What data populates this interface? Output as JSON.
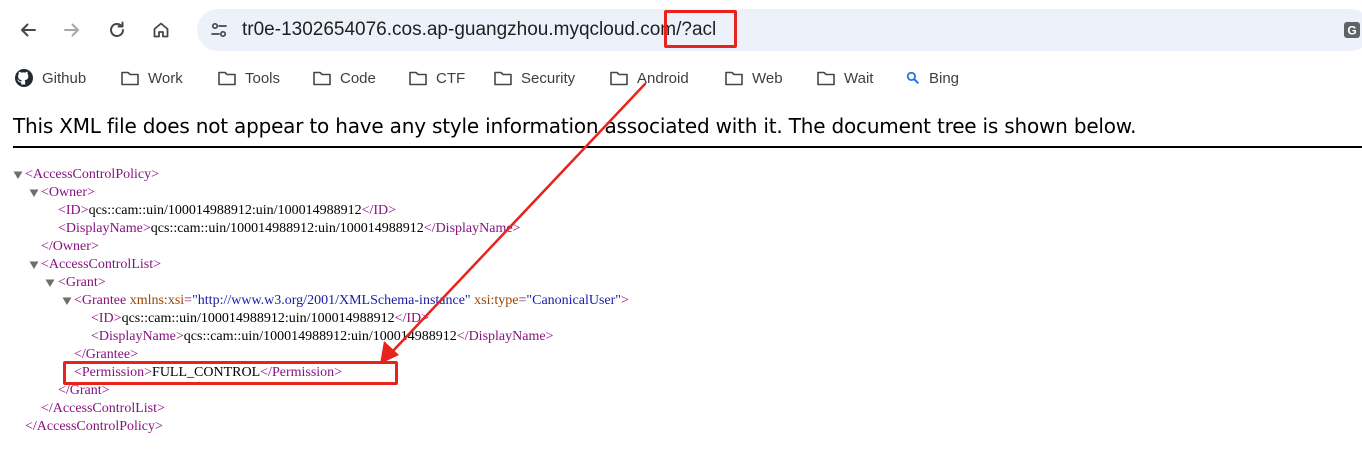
{
  "browser": {
    "url_text": "tr0e-1302654076.cos.ap-guangzhou.myqcloud.com/",
    "url_query": "?acl"
  },
  "bookmarks": [
    {
      "label": "Github",
      "icon": "github-icon"
    },
    {
      "label": "Work",
      "icon": "folder-icon"
    },
    {
      "label": "Tools",
      "icon": "folder-icon"
    },
    {
      "label": "Code",
      "icon": "folder-icon"
    },
    {
      "label": "CTF",
      "icon": "folder-icon"
    },
    {
      "label": "Security",
      "icon": "folder-icon"
    },
    {
      "label": "Android",
      "icon": "folder-icon"
    },
    {
      "label": "Web",
      "icon": "folder-icon"
    },
    {
      "label": "Wait",
      "icon": "folder-icon"
    },
    {
      "label": "Bing",
      "icon": "search-icon"
    }
  ],
  "notice": "This XML file does not appear to have any style information associated with it. The document tree is shown below.",
  "xml": {
    "root_open": "<AccessControlPolicy>",
    "owner_open": "<Owner>",
    "owner_id_open": "<ID>",
    "owner_id_value": "qcs::cam::uin/100014988912:uin/100014988912",
    "owner_id_close": "</ID>",
    "owner_dn_open": "<DisplayName>",
    "owner_dn_value": "qcs::cam::uin/100014988912:uin/100014988912",
    "owner_dn_close": "</DisplayName>",
    "owner_close": "</Owner>",
    "acl_open": "<AccessControlList>",
    "grant_open": "<Grant>",
    "grantee_tag": "<Grantee",
    "grantee_attr1_name": "xmlns:xsi",
    "grantee_attr1_value": "\"http://www.w3.org/2001/XMLSchema-instance\"",
    "grantee_attr2_name": "xsi:type",
    "grantee_attr2_value": "\"CanonicalUser\"",
    "grantee_tag_end": ">",
    "grantee_id_open": "<ID>",
    "grantee_id_value": "qcs::cam::uin/100014988912:uin/100014988912",
    "grantee_id_close": "</ID>",
    "grantee_dn_open": "<DisplayName>",
    "grantee_dn_value": "qcs::cam::uin/100014988912:uin/100014988912",
    "grantee_dn_close": "</DisplayName>",
    "grantee_close": "</Grantee>",
    "perm_open": "<Permission>",
    "perm_value": "FULL_CONTROL",
    "perm_close": "</Permission>",
    "grant_close": "</Grant>",
    "acl_close": "</AccessControlList>",
    "root_close": "</AccessControlPolicy>"
  },
  "colors": {
    "annotation_red": "#e8231b",
    "tag": "#881280",
    "attr_name": "#994500",
    "attr_value": "#1a1aa6"
  }
}
